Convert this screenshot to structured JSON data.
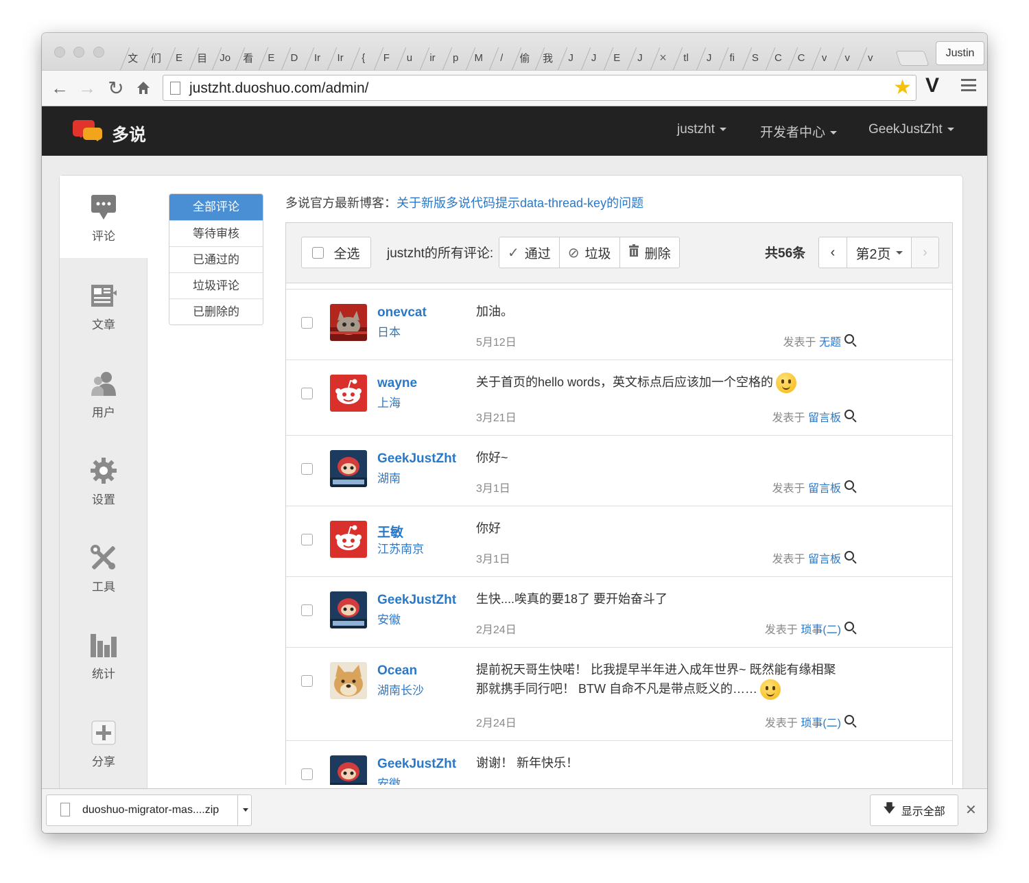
{
  "browser": {
    "tabs": [
      "文",
      "们",
      "E",
      "目",
      "Jo",
      "看",
      "E",
      "D",
      "Ir",
      "Ir",
      "{",
      "F",
      "u",
      "ir",
      "p",
      "M",
      "/",
      "偷",
      "我",
      "J",
      "J",
      "E",
      "J",
      "×",
      "tl",
      "J",
      "fi",
      "S",
      "C",
      "C",
      "v",
      "v",
      "v"
    ],
    "profile_name": "Justin",
    "url": "justzht.duoshuo.com/admin/",
    "icons": {
      "back": "arrow-left-icon",
      "forward": "arrow-right-icon",
      "reload": "reload-icon",
      "home": "home-icon",
      "star": "star-icon",
      "extension": "v-extension-icon",
      "menu": "hamburger-menu-icon"
    }
  },
  "header": {
    "brand": "多说",
    "nav": [
      "justzht",
      "开发者中心",
      "GeekJustZht"
    ]
  },
  "sidebar": {
    "items": [
      {
        "label": "评论",
        "icon": "comment-icon",
        "active": true
      },
      {
        "label": "文章",
        "icon": "article-icon"
      },
      {
        "label": "用户",
        "icon": "users-icon"
      },
      {
        "label": "设置",
        "icon": "gear-icon"
      },
      {
        "label": "工具",
        "icon": "tools-icon"
      },
      {
        "label": "统计",
        "icon": "stats-icon"
      },
      {
        "label": "分享",
        "icon": "share-plus-icon"
      }
    ]
  },
  "subnav": {
    "items": [
      "全部评论",
      "等待审核",
      "已通过的",
      "垃圾评论",
      "已删除的"
    ],
    "active_index": 0
  },
  "blog": {
    "prefix": "多说官方最新博客：",
    "link": "关于新版多说代码提示data-thread-key的问题"
  },
  "toolbar": {
    "select_all": "全选",
    "scope_label": "justzht的所有评论:",
    "approve": "通过",
    "spam": "垃圾",
    "delete": "删除",
    "total": "共56条",
    "page_label": "第2页"
  },
  "comments": [
    {
      "name": "onevcat",
      "location": "日本",
      "text": "加油。",
      "date": "5月12日",
      "thread_prefix": "发表于",
      "thread": "无题",
      "avatar": "cat"
    },
    {
      "name": "wayne",
      "location": "上海",
      "text": "关于首页的hello words，英文标点后应该加一个空格的",
      "emoji": "smile",
      "date": "3月21日",
      "thread_prefix": "发表于",
      "thread": "留言板",
      "avatar": "reddit"
    },
    {
      "name": "GeekJustZht",
      "location": "湖南",
      "text": "你好~",
      "date": "3月1日",
      "thread_prefix": "发表于",
      "thread": "留言板",
      "avatar": "octocat"
    },
    {
      "name": "王敏",
      "location": "江苏南京",
      "text": "你好",
      "date": "3月1日",
      "thread_prefix": "发表于",
      "thread": "留言板",
      "avatar": "reddit"
    },
    {
      "name": "GeekJustZht",
      "location": "安徽",
      "text": "生快....唉真的要18了 要开始奋斗了",
      "date": "2月24日",
      "thread_prefix": "发表于",
      "thread": "琐事(二)",
      "avatar": "octocat"
    },
    {
      "name": "Ocean",
      "location": "湖南长沙",
      "text": "提前祝天哥生快喏！ 比我提早半年进入成年世界~ 既然能有缘相聚 那就携手同行吧！ BTW 自命不凡是带点贬义的……",
      "emoji": "blush",
      "date": "2月24日",
      "thread_prefix": "发表于",
      "thread": "琐事(二)",
      "avatar": "doge"
    },
    {
      "name": "GeekJustZht",
      "location": "安徽",
      "text": "谢谢！ 新年快乐！",
      "avatar": "octocat"
    }
  ],
  "downloads": {
    "file": "duoshuo-migrator-mas....zip",
    "show_all": "显示全部"
  }
}
